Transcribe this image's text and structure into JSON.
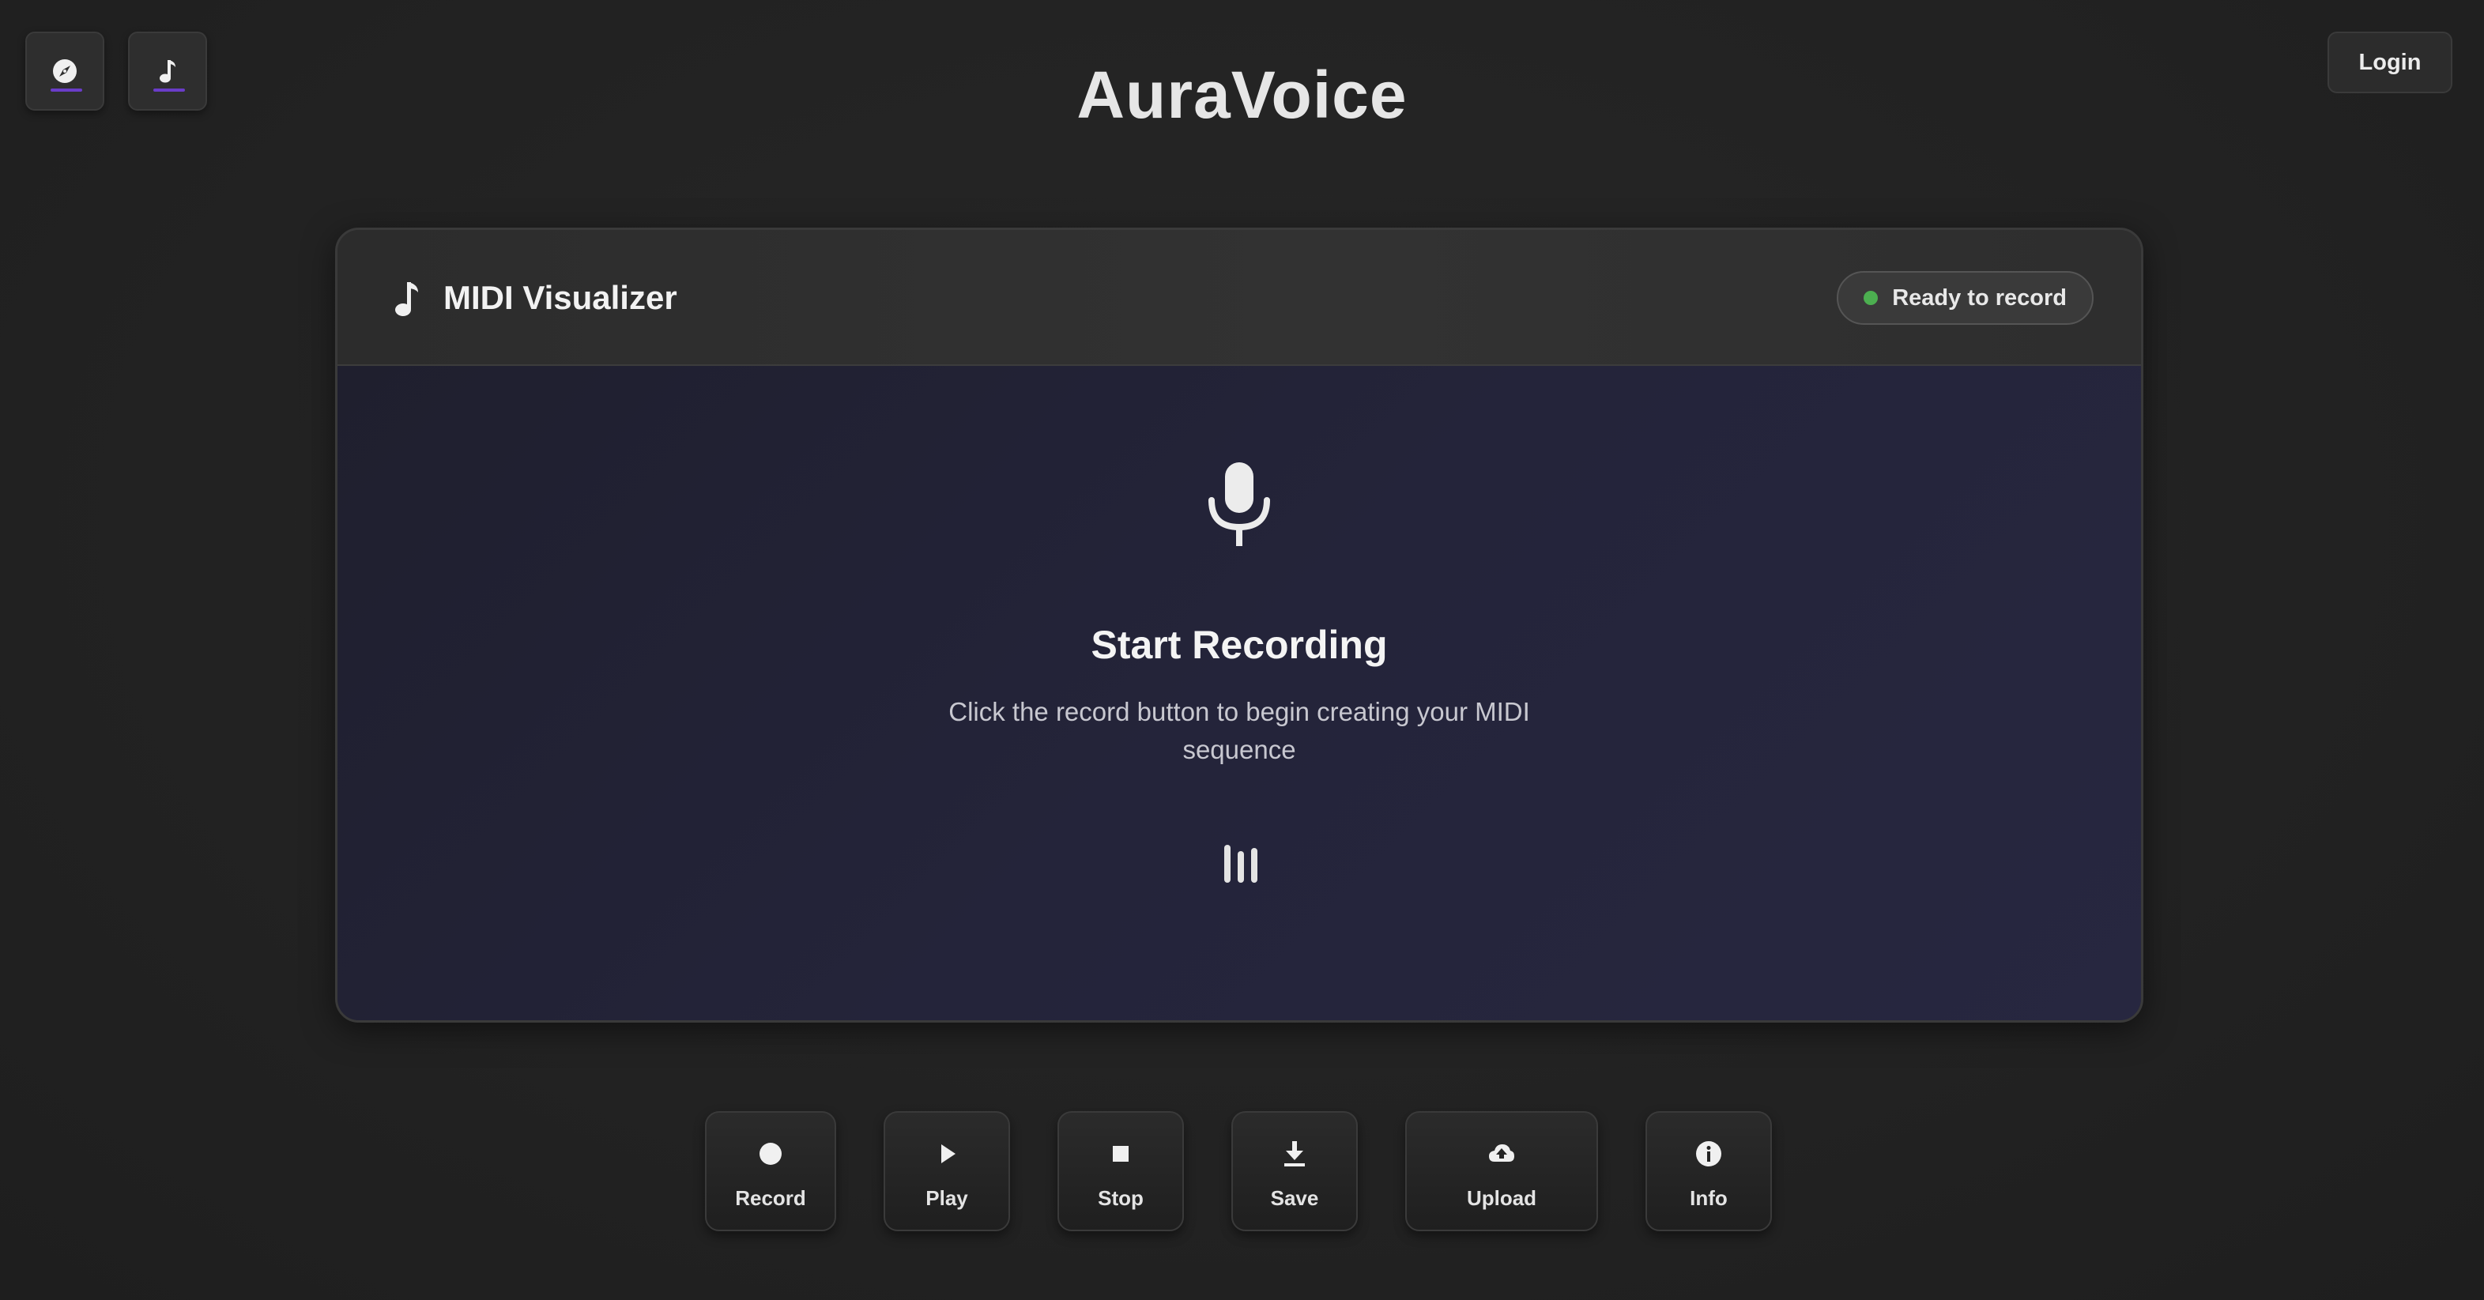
{
  "app": {
    "title": "AuraVoice"
  },
  "nav": {
    "items": [
      {
        "icon": "compass-icon"
      },
      {
        "icon": "music-note-icon"
      }
    ],
    "accent_color": "#6a3cc8"
  },
  "header": {
    "login_label": "Login"
  },
  "card": {
    "title": "MIDI Visualizer",
    "title_icon": "music-note-icon",
    "status": {
      "label": "Ready to record",
      "color": "#4caf50"
    }
  },
  "empty_state": {
    "icon": "microphone-icon",
    "title": "Start Recording",
    "description": "Click the record button to begin creating your MIDI sequence",
    "secondary_icon": "audio-bars-icon"
  },
  "controls": {
    "record": {
      "label": "Record",
      "icon": "record-icon"
    },
    "play": {
      "label": "Play",
      "icon": "play-icon"
    },
    "stop": {
      "label": "Stop",
      "icon": "stop-icon"
    },
    "save": {
      "label": "Save",
      "icon": "download-icon"
    },
    "upload": {
      "label": "Upload",
      "icon": "cloud-upload-icon"
    },
    "info": {
      "label": "Info",
      "icon": "info-icon"
    }
  }
}
